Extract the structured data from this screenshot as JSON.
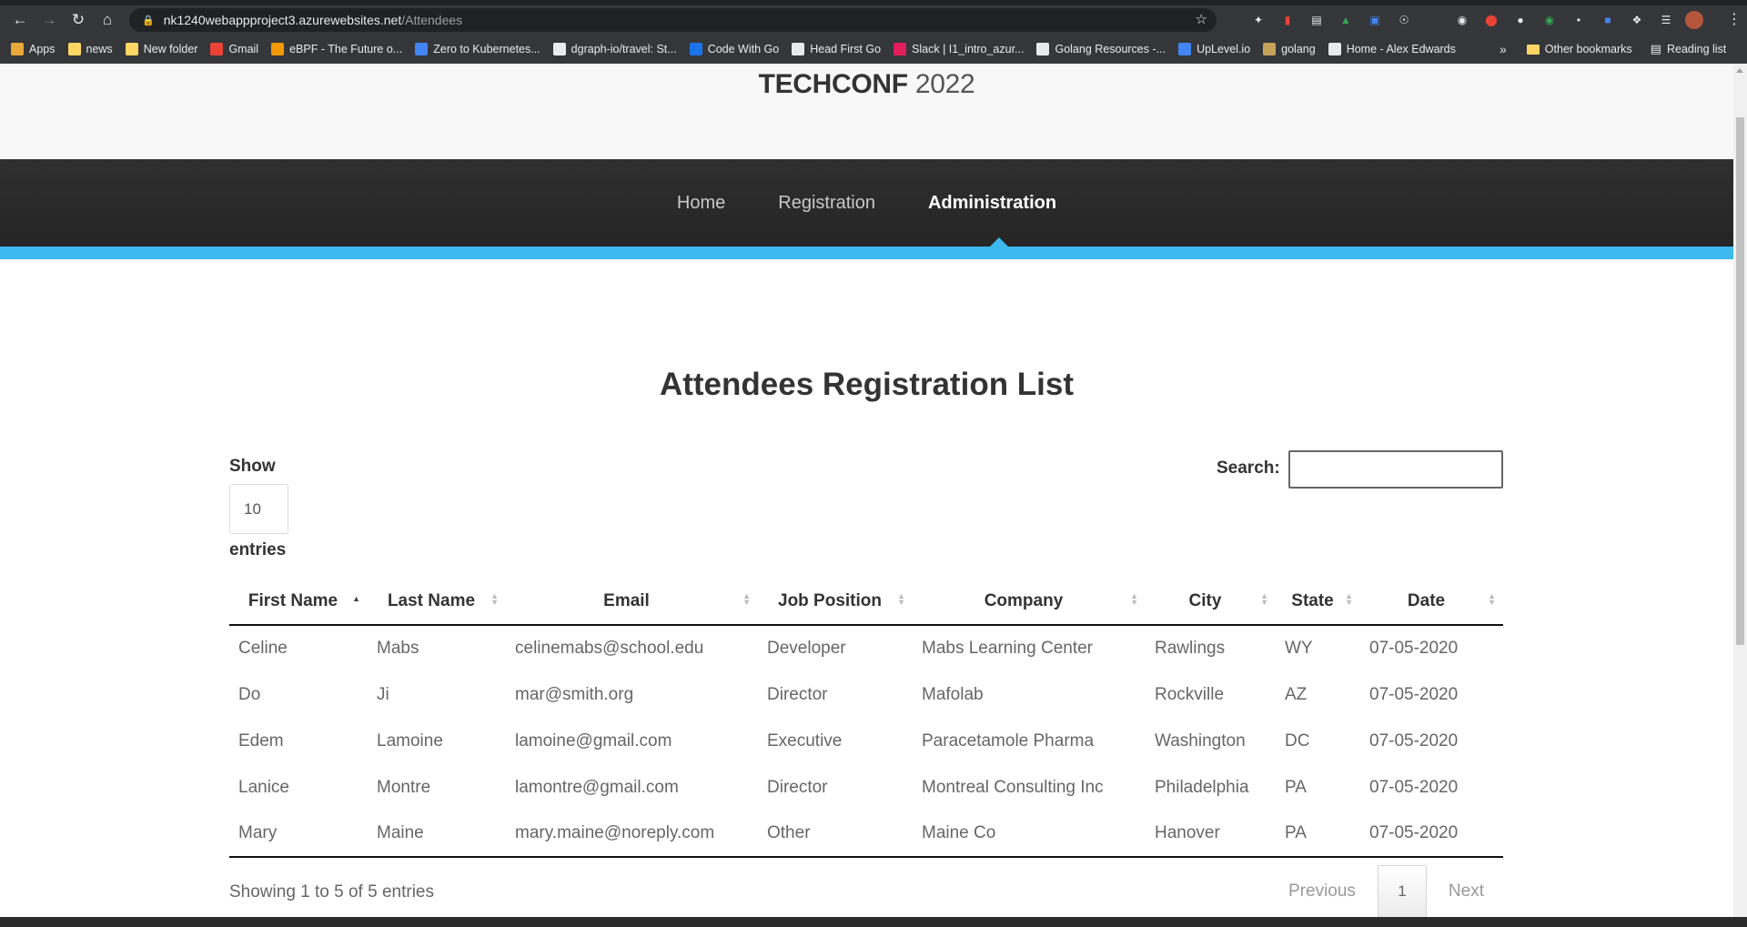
{
  "browser": {
    "url_host": "nk1240webappproject3.azurewebsites.net",
    "url_path": "/Attendees",
    "bookmarks": [
      {
        "label": "Apps",
        "color": "#e8a93a"
      },
      {
        "label": "news",
        "color": "#fdd663"
      },
      {
        "label": "New folder",
        "color": "#fdd663"
      },
      {
        "label": "Gmail",
        "color": "#ea4335"
      },
      {
        "label": "eBPF - The Future o...",
        "color": "#f29900"
      },
      {
        "label": "Zero to Kubernetes...",
        "color": "#4285f4"
      },
      {
        "label": "dgraph-io/travel: St...",
        "color": "#e8eaed"
      },
      {
        "label": "Code With Go",
        "color": "#1a73e8"
      },
      {
        "label": "Head First Go",
        "color": "#e8eaed"
      },
      {
        "label": "Slack | I1_intro_azur...",
        "color": "#e01e5a"
      },
      {
        "label": "Golang Resources -...",
        "color": "#e8eaed"
      },
      {
        "label": "UpLevel.io",
        "color": "#4285f4"
      },
      {
        "label": "golang",
        "color": "#c5a15a"
      },
      {
        "label": "Home - Alex Edwards",
        "color": "#e8eaed"
      }
    ],
    "overflow_label": "»",
    "other_bookmarks": "Other bookmarks",
    "reading_list": "Reading list"
  },
  "site": {
    "brand_main": "TECHCONF",
    "brand_year": "2022",
    "nav": [
      "Home",
      "Registration",
      "Administration"
    ],
    "active_nav": "Administration",
    "accent_color": "#3db9f0"
  },
  "page": {
    "title": "Attendees Registration List",
    "length_label": "Show",
    "length_value": "10",
    "length_suffix": "entries",
    "search_label": "Search:",
    "search_value": ""
  },
  "table": {
    "columns": [
      "First Name",
      "Last Name",
      "Email",
      "Job Position",
      "Company",
      "City",
      "State",
      "Date"
    ],
    "rows": [
      [
        "Celine",
        "Mabs",
        "celinemabs@school.edu",
        "Developer",
        "Mabs Learning Center",
        "Rawlings",
        "WY",
        "07-05-2020"
      ],
      [
        "Do",
        "Ji",
        "mar@smith.org",
        "Director",
        "Mafolab",
        "Rockville",
        "AZ",
        "07-05-2020"
      ],
      [
        "Edem",
        "Lamoine",
        "lamoine@gmail.com",
        "Executive",
        "Paracetamole Pharma",
        "Washington",
        "DC",
        "07-05-2020"
      ],
      [
        "Lanice",
        "Montre",
        "lamontre@gmail.com",
        "Director",
        "Montreal Consulting Inc",
        "Philadelphia",
        "PA",
        "07-05-2020"
      ],
      [
        "Mary",
        "Maine",
        "mary.maine@noreply.com",
        "Other",
        "Maine Co",
        "Hanover",
        "PA",
        "07-05-2020"
      ]
    ],
    "info": "Showing 1 to 5 of 5 entries",
    "pager": {
      "previous": "Previous",
      "current": "1",
      "next": "Next"
    }
  }
}
